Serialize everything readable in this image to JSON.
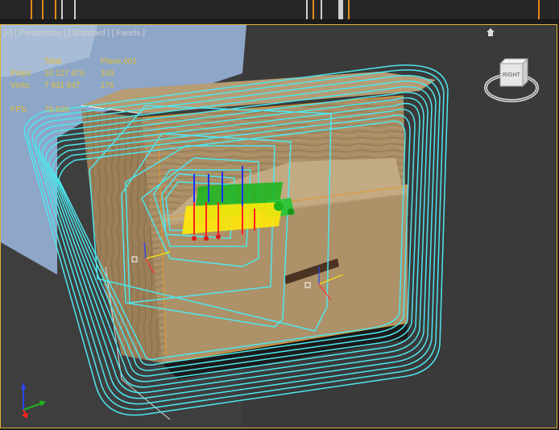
{
  "viewport": {
    "labels": [
      {
        "text": "[+]"
      },
      {
        "text": "[ Perspective ]"
      },
      {
        "text": "[ Standard ]"
      },
      {
        "text": "[ Facets ]"
      }
    ]
  },
  "stats": {
    "header": {
      "total": "Total",
      "object": "Plane.001"
    },
    "polys": {
      "label": "Polys:",
      "total": "10 127 476",
      "object": "169"
    },
    "verts": {
      "label": "Verts:",
      "total": "7 931 847",
      "object": "176"
    },
    "fps": {
      "label": "FPS:",
      "value": "79,820"
    }
  },
  "viewcube": {
    "face": "RIGHT"
  },
  "colors": {
    "accent_border": "#d9b43a",
    "stats_text": "#e0c23a",
    "selection_wire": "#4fe6ee",
    "wood": "#a58a62"
  },
  "icons": [
    "home-icon",
    "axis-gizmo-icon",
    "viewcube-icon"
  ]
}
